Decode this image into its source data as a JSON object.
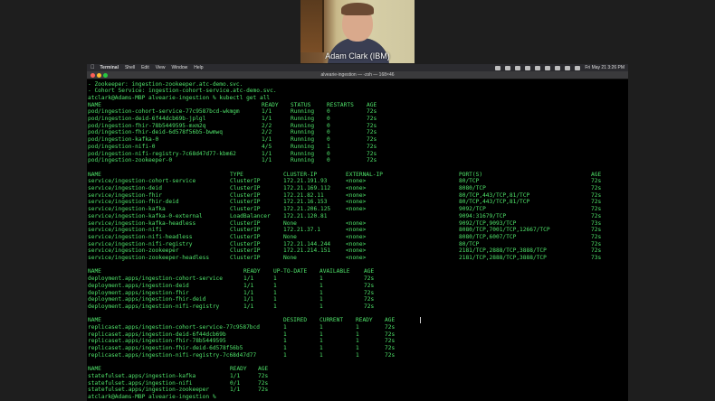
{
  "video": {
    "participant_name": "Adam Clark (IBM)"
  },
  "menubar": {
    "app_name": "Terminal",
    "items": [
      "Shell",
      "Edit",
      "View",
      "Window",
      "Help"
    ],
    "clock": "Fri May 21  3:26 PM"
  },
  "window": {
    "title": "alvearie-ingestion — -zsh — 168×46"
  },
  "terminal": {
    "lines": [
      [
        "- Zookeeper: ingestion-zookeeper.atc-demo.svc."
      ],
      [
        "- Cohort Service: ingestion-cohort-service.atc-demo.svc."
      ],
      [
        "atclark@Adams-MBP alvearie-ingestion % kubectl get all"
      ],
      [
        "NAME",
        "READY",
        "STATUS",
        "RESTARTS",
        "AGE"
      ],
      [
        "pod/ingestion-cohort-service-77c9587bcd-wkmgm",
        "1/1",
        "Running",
        "0",
        "72s"
      ],
      [
        "pod/ingestion-deid-6f44dcb69b-jplgl",
        "1/1",
        "Running",
        "0",
        "72s"
      ],
      [
        "pod/ingestion-fhir-78b5449595-mxm2q",
        "2/2",
        "Running",
        "0",
        "72s"
      ],
      [
        "pod/ingestion-fhir-deid-6d578f56b5-bwmwq",
        "2/2",
        "Running",
        "0",
        "72s"
      ],
      [
        "pod/ingestion-kafka-0",
        "1/1",
        "Running",
        "0",
        "72s"
      ],
      [
        "pod/ingestion-nifi-0",
        "4/5",
        "Running",
        "1",
        "72s"
      ],
      [
        "pod/ingestion-nifi-registry-7c68d47d77-kbm62",
        "1/1",
        "Running",
        "0",
        "72s"
      ],
      [
        "pod/ingestion-zookeeper-0",
        "1/1",
        "Running",
        "0",
        "72s"
      ],
      [
        ""
      ],
      [
        "NAME",
        "TYPE",
        "CLUSTER-IP",
        "EXTERNAL-IP",
        "PORT(S)",
        "AGE"
      ],
      [
        "service/ingestion-cohort-service",
        "ClusterIP",
        "172.21.191.93",
        "<none>",
        "80/TCP",
        "72s"
      ],
      [
        "service/ingestion-deid",
        "ClusterIP",
        "172.21.169.112",
        "<none>",
        "8080/TCP",
        "72s"
      ],
      [
        "service/ingestion-fhir",
        "ClusterIP",
        "172.21.82.11",
        "<none>",
        "80/TCP,443/TCP,81/TCP",
        "72s"
      ],
      [
        "service/ingestion-fhir-deid",
        "ClusterIP",
        "172.21.16.153",
        "<none>",
        "80/TCP,443/TCP,81/TCP",
        "72s"
      ],
      [
        "service/ingestion-kafka",
        "ClusterIP",
        "172.21.206.125",
        "<none>",
        "9092/TCP",
        "72s"
      ],
      [
        "service/ingestion-kafka-0-external",
        "LoadBalancer",
        "172.21.120.81",
        "",
        "9094:31679/TCP",
        "72s"
      ],
      [
        "service/ingestion-kafka-headless",
        "ClusterIP",
        "None",
        "<none>",
        "9092/TCP,9093/TCP",
        "73s"
      ],
      [
        "service/ingestion-nifi",
        "ClusterIP",
        "172.21.37.1",
        "<none>",
        "8080/TCP,7001/TCP,12667/TCP",
        "72s"
      ],
      [
        "service/ingestion-nifi-headless",
        "ClusterIP",
        "None",
        "<none>",
        "8080/TCP,6007/TCP",
        "72s"
      ],
      [
        "service/ingestion-nifi-registry",
        "ClusterIP",
        "172.21.144.244",
        "<none>",
        "80/TCP",
        "72s"
      ],
      [
        "service/ingestion-zookeeper",
        "ClusterIP",
        "172.21.214.151",
        "<none>",
        "2181/TCP,2888/TCP,3888/TCP",
        "72s"
      ],
      [
        "service/ingestion-zookeeper-headless",
        "ClusterIP",
        "None",
        "<none>",
        "2181/TCP,2888/TCP,3888/TCP",
        "73s"
      ],
      [
        ""
      ],
      [
        "NAME",
        "READY",
        "UP-TO-DATE",
        "AVAILABLE",
        "AGE"
      ],
      [
        "deployment.apps/ingestion-cohort-service",
        "1/1",
        "1",
        "1",
        "72s"
      ],
      [
        "deployment.apps/ingestion-deid",
        "1/1",
        "1",
        "1",
        "72s"
      ],
      [
        "deployment.apps/ingestion-fhir",
        "1/1",
        "1",
        "1",
        "72s"
      ],
      [
        "deployment.apps/ingestion-fhir-deid",
        "1/1",
        "1",
        "1",
        "72s"
      ],
      [
        "deployment.apps/ingestion-nifi-registry",
        "1/1",
        "1",
        "1",
        "72s"
      ],
      [
        ""
      ],
      [
        "NAME",
        "DESIRED",
        "CURRENT",
        "READY",
        "AGE"
      ],
      [
        "replicaset.apps/ingestion-cohort-service-77c9587bcd",
        "1",
        "1",
        "1",
        "72s"
      ],
      [
        "replicaset.apps/ingestion-deid-6f44dcb69b",
        "1",
        "1",
        "1",
        "72s"
      ],
      [
        "replicaset.apps/ingestion-fhir-78b5449595",
        "1",
        "1",
        "1",
        "72s"
      ],
      [
        "replicaset.apps/ingestion-fhir-deid-6d578f56b5",
        "1",
        "1",
        "1",
        "72s"
      ],
      [
        "replicaset.apps/ingestion-nifi-registry-7c68d47d77",
        "1",
        "1",
        "1",
        "72s"
      ],
      [
        ""
      ],
      [
        "NAME",
        "READY",
        "AGE"
      ],
      [
        "statefulset.apps/ingestion-kafka",
        "1/1",
        "72s"
      ],
      [
        "statefulset.apps/ingestion-nifi",
        "0/1",
        "72s"
      ],
      [
        "statefulset.apps/ingestion-zookeeper",
        "1/1",
        "72s"
      ],
      [
        "atclark@Adams-MBP alvearie-ingestion % "
      ]
    ]
  }
}
